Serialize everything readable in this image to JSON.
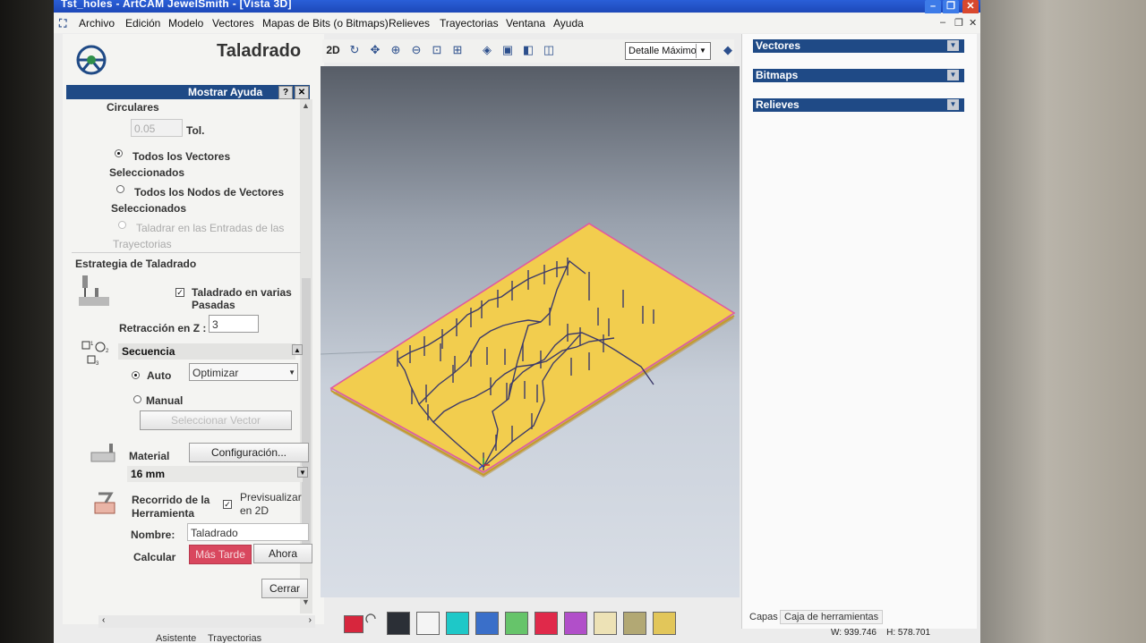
{
  "window": {
    "title": "Tst_holes - ArtCAM JewelSmith - [Vista 3D]",
    "min_glyph": "–",
    "restore_glyph": "❐",
    "close_glyph": "✕"
  },
  "menu": [
    "Archivo",
    "Edición",
    "Modelo",
    "Vectores",
    "Mapas de Bits (o Bitmaps)",
    "Relieves",
    "Trayectorias",
    "Ventana",
    "Ayuda"
  ],
  "mdi_controls": [
    "–",
    "❐",
    "✕"
  ],
  "left_panel": {
    "title": "Taladrado",
    "help_bar": "Mostrar Ayuda",
    "help_q": "?",
    "help_x": "✕",
    "circulares": "Circulares",
    "tol_value": "0.05",
    "tol_label": "Tol.",
    "radio_all_vectors": "Todos los Vectores Seleccionados",
    "radio_all_nodes": "Todos los Nodos de Vectores Seleccionados",
    "radio_entries": "Taladrar en las Entradas de las Trayectorias",
    "strategy_title": "Estrategia de Taladrado",
    "multi_pass": "Taladrado en varias Pasadas",
    "retraction_label": "Retracción en Z :",
    "retraction_value": "3",
    "sequence_title": "Secuencia",
    "auto_label": "Auto",
    "auto_select": "Optimizar",
    "manual_label": "Manual",
    "select_vector_btn": "Seleccionar Vector",
    "material_label": "Material",
    "config_btn": "Configuración...",
    "material_value": "16 mm",
    "toolpath_label": "Recorrido de la Herramienta",
    "preview_label": "Previsualizar en 2D",
    "name_label": "Nombre:",
    "name_value": "Taladrado",
    "calc_label": "Calcular",
    "later_btn": "Más Tarde",
    "now_btn": "Ahora",
    "close_btn": "Cerrar",
    "bottom_tabs": [
      "Asistente",
      "Trayectorias"
    ]
  },
  "toolbar": {
    "mode_2d": "2D",
    "detail_select": "Detalle Máximo",
    "icons": [
      "rotate-icon",
      "pan-icon",
      "zoom-in-icon",
      "zoom-out-icon",
      "zoom-box-icon",
      "zoom-fit-icon",
      "iso-view-icon",
      "front-view-icon",
      "side-view-icon",
      "top-view-icon",
      "shade-icon",
      "axes-icon",
      "light-icon"
    ]
  },
  "palette": [
    "#d7263d",
    "#2b2f36",
    "#f4f4f4",
    "#1ec8c8",
    "#3a6fc9",
    "#66c46a",
    "#e0294a",
    "#b14fc9",
    "#ede2b6",
    "#b2a874",
    "#e2c65a"
  ],
  "right_panel": {
    "bars": [
      "Vectores",
      "Bitmaps",
      "Relieves"
    ],
    "tabs": [
      "Capas",
      "Caja de herramientas"
    ]
  },
  "status": {
    "width": "W: 939.746",
    "height": "H: 578.701"
  },
  "colors": {
    "accent": "#1f4a86",
    "board_fill": "#f2cd4e",
    "board_edge": "#e05aa0"
  }
}
